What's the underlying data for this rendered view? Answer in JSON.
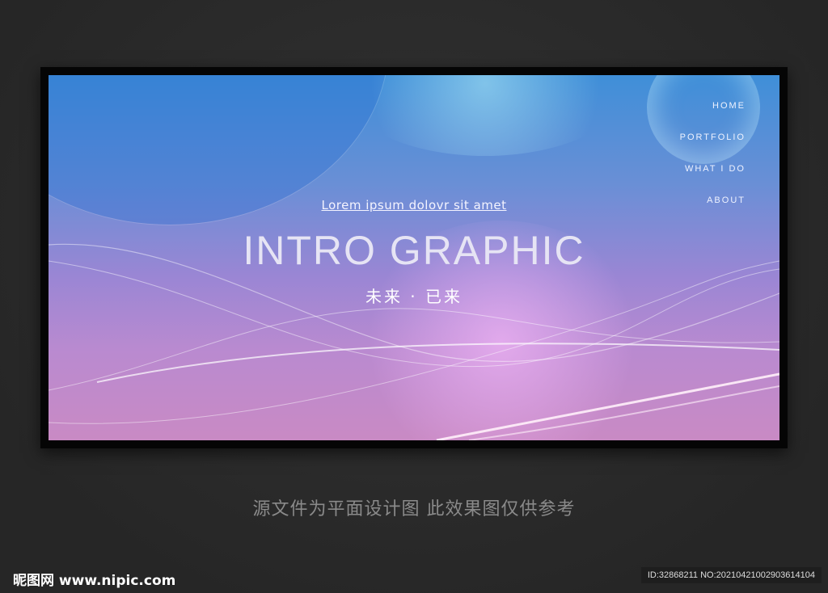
{
  "nav": {
    "items": [
      "HOME",
      "PORTFOLIO",
      "WHAT I DO",
      "ABOUT"
    ]
  },
  "hero": {
    "subtitle": "Lorem ipsum dolovr sit amet",
    "title": "INTRO GRAPHIC",
    "chinese_tagline": "未来 · 已来"
  },
  "caption": "源文件为平面设计图 此效果图仅供参考",
  "watermark": {
    "logo": "昵图网 www.nipic.com",
    "id": "ID:32868211 NO:20210421002903614104"
  }
}
